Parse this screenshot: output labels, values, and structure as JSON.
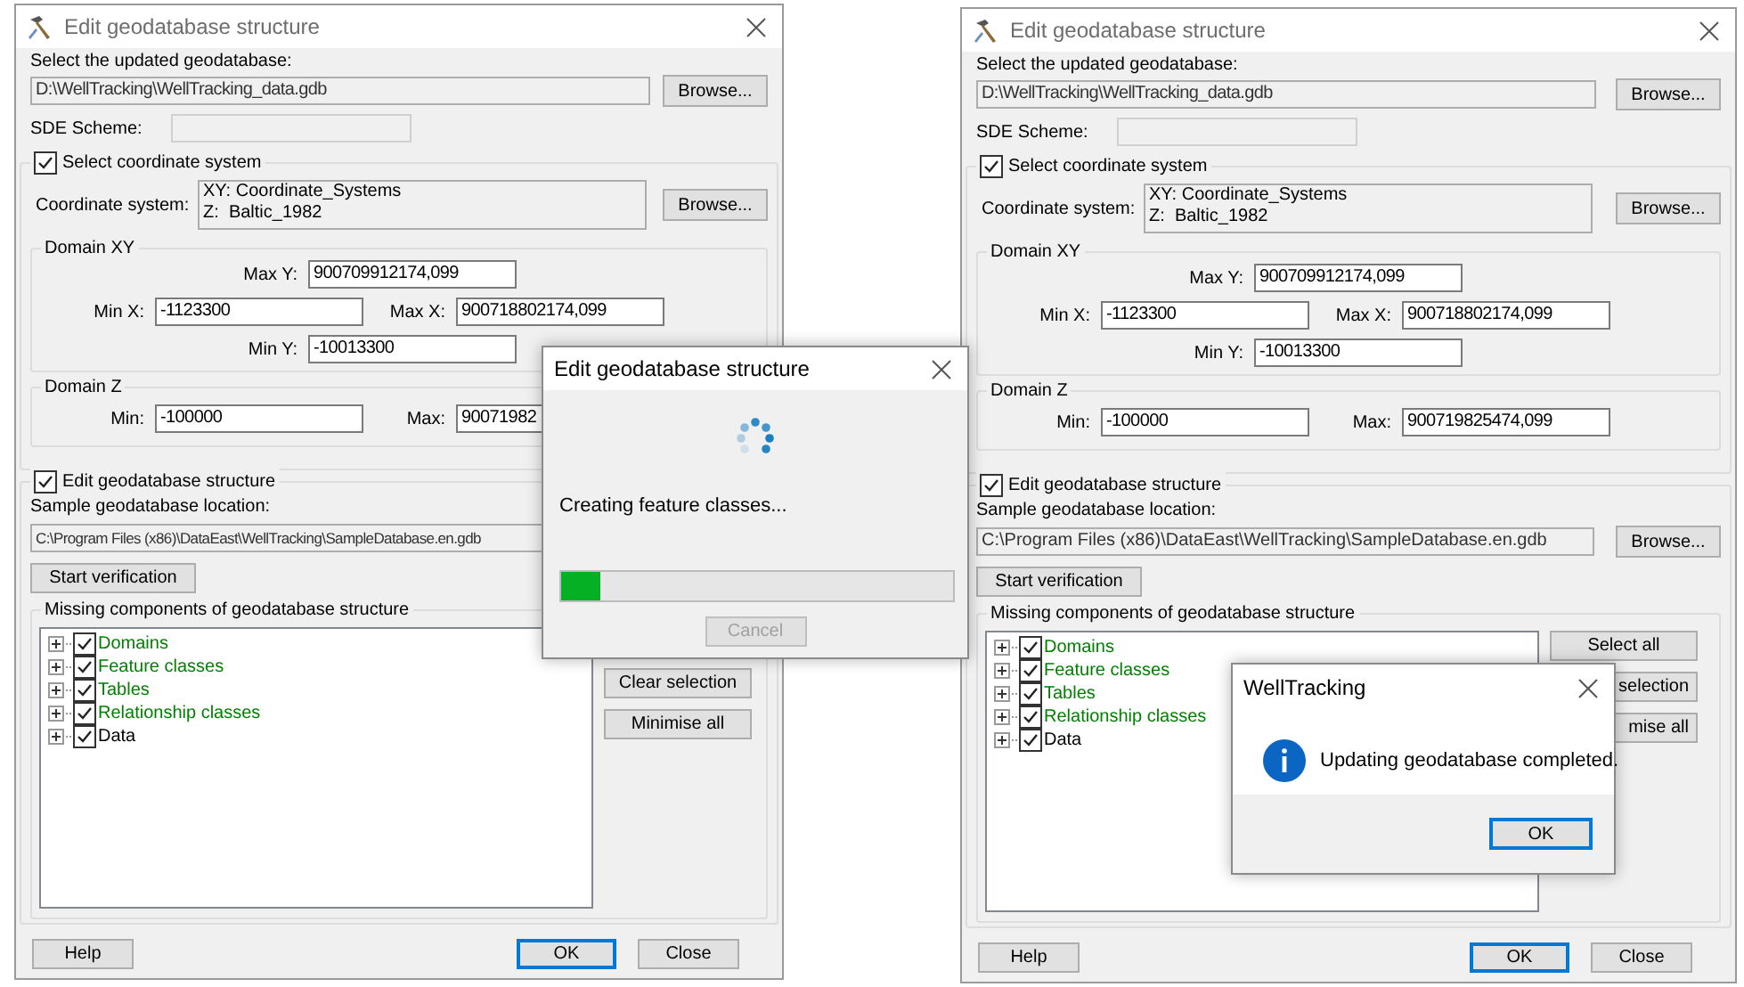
{
  "dialogs": [
    {
      "title": "Edit geodatabase structure",
      "geodatabase": {
        "label": "Select the updated geodatabase:",
        "path": "D:\\WellTracking\\WellTracking_data.gdb",
        "browse": "Browse..."
      },
      "sde": {
        "label": "SDE Scheme:"
      },
      "coordinate_system": {
        "checkbox": {
          "label": "Select coordinate system",
          "checked": true
        },
        "label": "Coordinate system:",
        "lines": [
          "XY: Coordinate_Systems",
          "Z:  Baltic_1982"
        ],
        "browse": "Browse..."
      },
      "domain_xy": {
        "title": "Domain XY",
        "max_y": {
          "label": "Max Y:",
          "value": "900709912174,099"
        },
        "min_x": {
          "label": "Min X:",
          "value": "-1123300"
        },
        "max_x": {
          "label": "Max X:",
          "value": "900718802174,099"
        },
        "min_y": {
          "label": "Min Y:",
          "value": "-10013300"
        }
      },
      "domain_z": {
        "title": "Domain Z",
        "min": {
          "label": "Min:",
          "value": "-100000"
        },
        "max": {
          "label": "Max:",
          "value": "90071982"
        }
      },
      "structure": {
        "checkbox": {
          "label": "Edit geodatabase structure",
          "checked": true
        },
        "sample_label": "Sample geodatabase location:",
        "sample_path": "C:\\Program Files (x86)\\DataEast\\WellTracking\\SampleDatabase.en.gdb",
        "verify_button": "Start verification",
        "missing": {
          "title": "Missing components of geodatabase structure",
          "items": [
            {
              "label": "Domains",
              "checked": true,
              "color": "#008000"
            },
            {
              "label": "Feature classes",
              "checked": true,
              "color": "#008000"
            },
            {
              "label": "Tables",
              "checked": true,
              "color": "#008000"
            },
            {
              "label": "Relationship classes",
              "checked": true,
              "color": "#008000"
            },
            {
              "label": "Data",
              "checked": true,
              "color": "#000000"
            }
          ],
          "buttons": [
            {
              "label": "Clear selection",
              "clipped": false
            },
            {
              "label": "Minimise all",
              "clipped": false
            }
          ]
        }
      },
      "buttons": [
        {
          "label": "Help",
          "focused": false
        },
        {
          "label": "OK",
          "focused": true
        },
        {
          "label": "Close",
          "focused": false
        }
      ],
      "overlay": {
        "kind": "progress",
        "title": "Edit geodatabase structure",
        "message": "Creating feature classes...",
        "level": 0.1,
        "cancel": {
          "label": "Cancel",
          "disabled": true
        }
      }
    },
    {
      "title": "Edit geodatabase structure",
      "geodatabase": {
        "label": "Select the updated geodatabase:",
        "path": "D:\\WellTracking\\WellTracking_data.gdb",
        "browse": "Browse..."
      },
      "sde": {
        "label": "SDE Scheme:"
      },
      "coordinate_system": {
        "checkbox": {
          "label": "Select coordinate system",
          "checked": true
        },
        "label": "Coordinate system:",
        "lines": [
          "XY: Coordinate_Systems",
          "Z:  Baltic_1982"
        ],
        "browse": "Browse..."
      },
      "domain_xy": {
        "title": "Domain XY",
        "max_y": {
          "label": "Max Y:",
          "value": "900709912174,099"
        },
        "min_x": {
          "label": "Min X:",
          "value": "-1123300"
        },
        "max_x": {
          "label": "Max X:",
          "value": "900718802174,099"
        },
        "min_y": {
          "label": "Min Y:",
          "value": "-10013300"
        }
      },
      "domain_z": {
        "title": "Domain Z",
        "min": {
          "label": "Min:",
          "value": "-100000"
        },
        "max": {
          "label": "Max:",
          "value": "900719825474,099"
        }
      },
      "structure": {
        "checkbox": {
          "label": "Edit geodatabase structure",
          "checked": true
        },
        "sample_label": "Sample geodatabase location:",
        "sample_path": "C:\\Program Files (x86)\\DataEast\\WellTracking\\SampleDatabase.en.gdb",
        "browse": "Browse...",
        "verify_button": "Start verification",
        "missing": {
          "title": "Missing components of geodatabase structure",
          "items": [
            {
              "label": "Domains",
              "checked": true,
              "color": "#008000"
            },
            {
              "label": "Feature classes",
              "checked": true,
              "color": "#008000"
            },
            {
              "label": "Tables",
              "checked": true,
              "color": "#008000"
            },
            {
              "label": "Relationship classes",
              "checked": true,
              "color": "#008000"
            },
            {
              "label": "Data",
              "checked": true,
              "color": "#000000"
            }
          ],
          "buttons": [
            {
              "label": "Select all",
              "clipped": false
            },
            {
              "label": "selection",
              "clipped": true
            },
            {
              "label": "mise all",
              "clipped": true
            }
          ]
        }
      },
      "buttons": [
        {
          "label": "Help",
          "focused": false
        },
        {
          "label": "OK",
          "focused": true
        },
        {
          "label": "Close",
          "focused": false
        }
      ],
      "overlay": {
        "kind": "message",
        "title": "WellTracking",
        "message": "Updating geodatabase completed.",
        "ok": {
          "label": "OK",
          "focused": true
        }
      }
    }
  ]
}
